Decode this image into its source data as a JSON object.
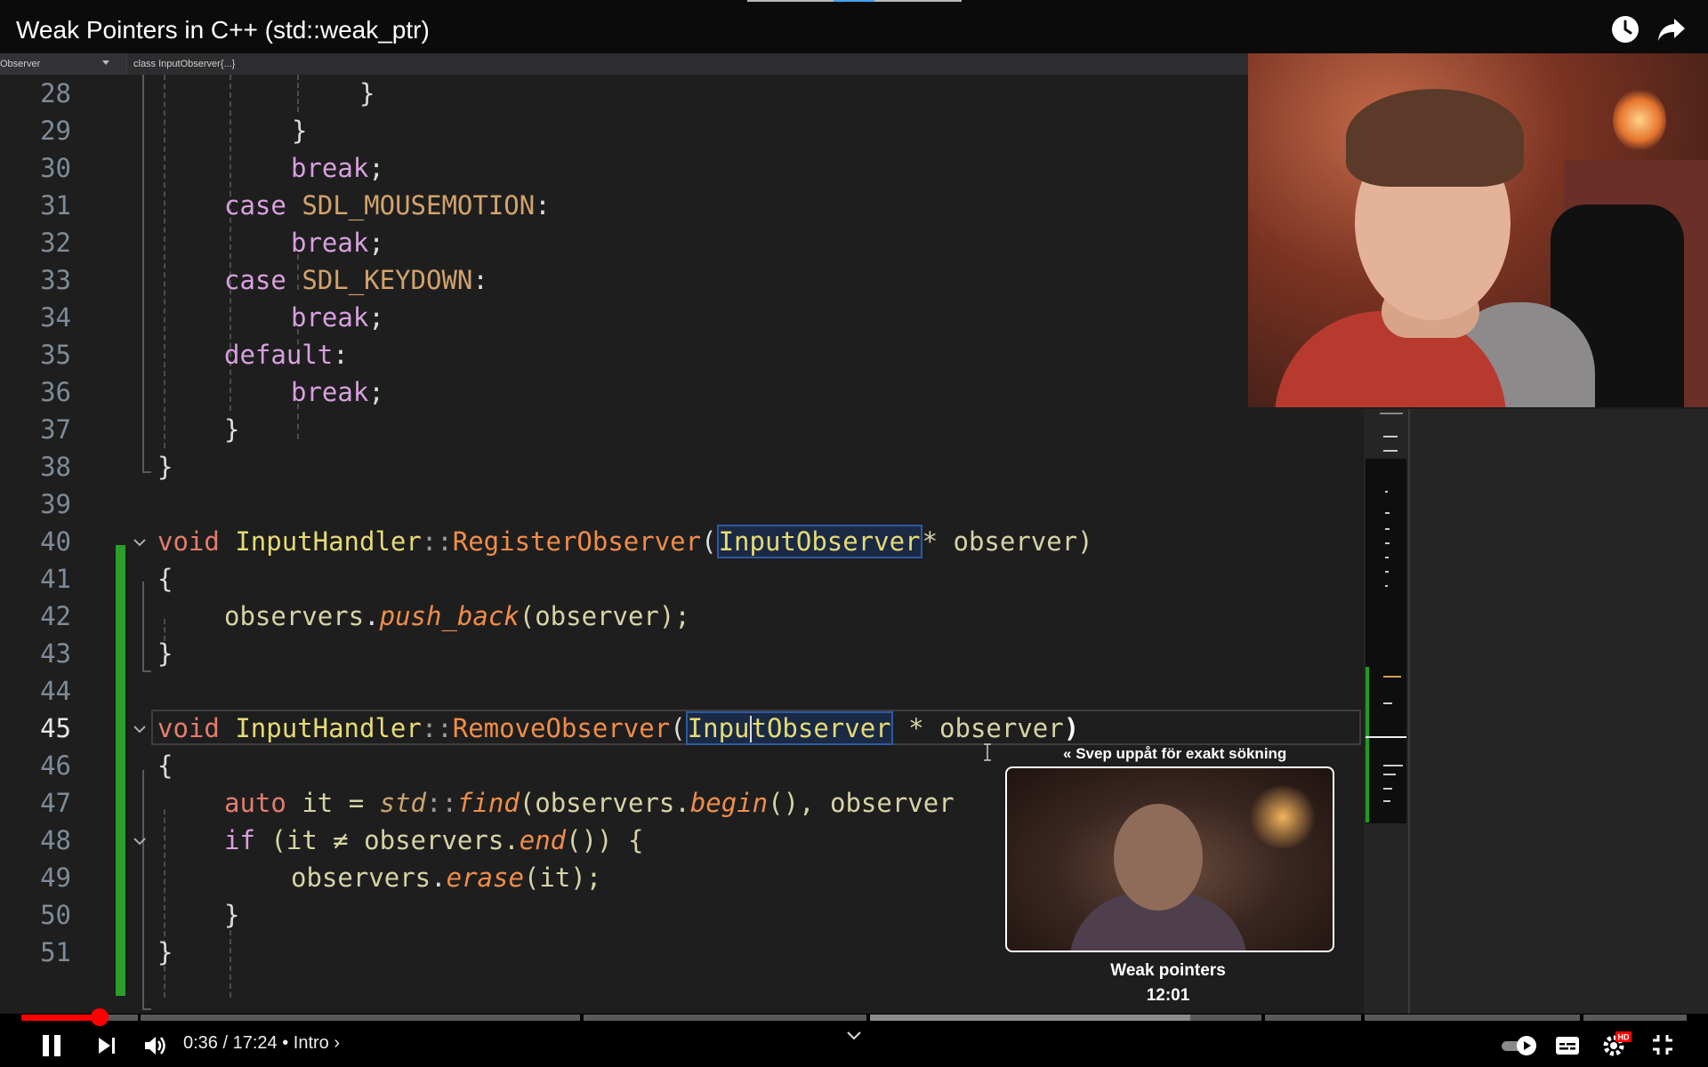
{
  "window": {
    "title": "Weak Pointers in C++ (std::weak_ptr)"
  },
  "editor": {
    "nav_left": "Observer",
    "nav_right": "class InputObserver{...}",
    "current_line": 45,
    "lines": [
      {
        "n": "28"
      },
      {
        "n": "29"
      },
      {
        "n": "30"
      },
      {
        "n": "31"
      },
      {
        "n": "32"
      },
      {
        "n": "33"
      },
      {
        "n": "34"
      },
      {
        "n": "35"
      },
      {
        "n": "36"
      },
      {
        "n": "37"
      },
      {
        "n": "38"
      },
      {
        "n": "39"
      },
      {
        "n": "40"
      },
      {
        "n": "41"
      },
      {
        "n": "42"
      },
      {
        "n": "43"
      },
      {
        "n": "44"
      },
      {
        "n": "45"
      },
      {
        "n": "46"
      },
      {
        "n": "47"
      },
      {
        "n": "48"
      },
      {
        "n": "49"
      },
      {
        "n": "50"
      },
      {
        "n": "51"
      }
    ],
    "tokens": {
      "brace_close": "}",
      "brace_open": "{",
      "break": "break",
      "semi": ";",
      "case": "case ",
      "mousemotion": "SDL_MOUSEMOTION",
      "keydown": "SDL_KEYDOWN",
      "colon": ":",
      "default": "default",
      "void": "void ",
      "input_handler": "InputHandler",
      "scope": "::",
      "register_observer": "RegisterObserver",
      "remove_observer": "RemoveObserver",
      "paren_open": "(",
      "input_observer": "InputObserver",
      "input_observer_a": "Inpu",
      "input_observer_b": "tObserver",
      "star_observer": "* observer)",
      "space_star_observer": " * observer",
      "paren_close": ")",
      "observers": "observers",
      "dot": ".",
      "push_back": "push_back",
      "push_args": "(observer);",
      "auto": "auto ",
      "it_eq": "it = ",
      "std": "std",
      "find": "find",
      "find_open": "(observers.",
      "begin": "begin",
      "find_rest": "(), observer",
      "if": "if ",
      "if_cond": "(it ≠ observers.",
      "end": "end",
      "if_rest": "()) {",
      "erase": "erase",
      "erase_args": "(it);"
    }
  },
  "preview": {
    "hint": "Svep uppåt för exakt sökning",
    "title": "Weak pointers",
    "time": "12:01"
  },
  "player": {
    "time_display": "0:36 / 17:24 • Intro ›",
    "progress_fraction": 0.0347,
    "icons": [
      "clock-icon",
      "share-icon",
      "pause-icon",
      "next-icon",
      "volume-icon",
      "chevron-down-icon",
      "autoplay-toggle",
      "subtitles-icon",
      "settings-icon",
      "exit-fullscreen-icon"
    ],
    "hd_badge": "HD",
    "accent": "#ff0000"
  }
}
